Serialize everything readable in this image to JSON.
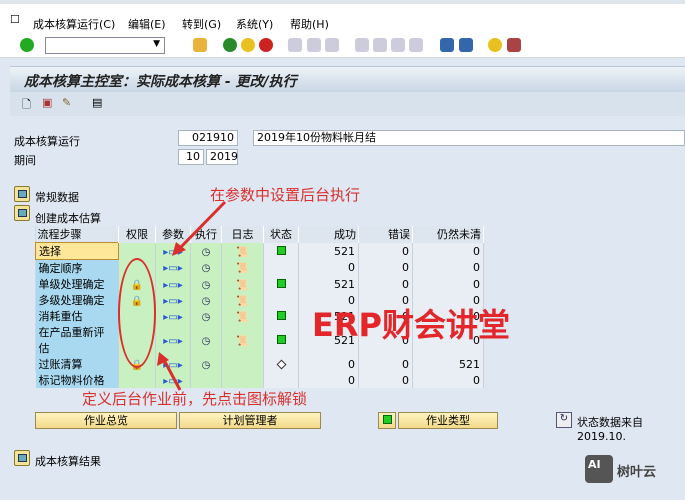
{
  "menu": [
    "成本核算运行(C)",
    "编辑(E)",
    "转到(G)",
    "系统(Y)",
    "帮助(H)"
  ],
  "title": "成本核算主控室：实际成本核算 - 更改/执行",
  "header": {
    "run_label": "成本核算运行",
    "run_value": "021910",
    "run_desc": "2019年10份物料帐月结",
    "period_label": "期间",
    "period": "10",
    "year": "2019"
  },
  "sections": {
    "general": "常规数据",
    "create": "创建成本估算",
    "results": "成本核算结果"
  },
  "table": {
    "columns": [
      "流程步骤",
      "权限",
      "参数",
      "执行",
      "日志",
      "状态",
      "成功",
      "错误",
      "仍然未清"
    ],
    "rows": [
      {
        "step": "选择",
        "lock": false,
        "exec": true,
        "log": true,
        "status": "green",
        "ok": "521",
        "err": "0",
        "open": "0"
      },
      {
        "step": "确定顺序",
        "lock": false,
        "exec": true,
        "log": true,
        "status": "",
        "ok": "0",
        "err": "0",
        "open": "0"
      },
      {
        "step": "单级处理确定",
        "lock": true,
        "exec": true,
        "log": true,
        "status": "green",
        "ok": "521",
        "err": "0",
        "open": "0"
      },
      {
        "step": "多级处理确定",
        "lock": true,
        "exec": true,
        "log": true,
        "status": "",
        "ok": "0",
        "err": "0",
        "open": "0"
      },
      {
        "step": "消耗重估",
        "lock": false,
        "exec": true,
        "log": true,
        "status": "green",
        "ok": "521",
        "err": "0",
        "open": "0"
      },
      {
        "step": "在产品重新评估",
        "lock": false,
        "exec": true,
        "log": true,
        "status": "green",
        "ok": "521",
        "err": "0",
        "open": "0"
      },
      {
        "step": "过账清算",
        "lock": true,
        "exec": true,
        "log": false,
        "status": "diamond",
        "ok": "0",
        "err": "0",
        "open": "521"
      },
      {
        "step": "标记物料价格",
        "lock": false,
        "exec": false,
        "log": false,
        "status": "",
        "ok": "0",
        "err": "0",
        "open": "0"
      }
    ]
  },
  "buttons": {
    "overview": "作业总览",
    "scheduler": "计划管理者",
    "jobtype": "作业类型"
  },
  "status_text": "状态数据来自 2019.10.",
  "annotations": {
    "top": "在参数中设置后台执行",
    "bottom": "定义后台作业前，先点击图标解锁",
    "watermark": "ERP财会讲堂",
    "logo": "树叶云"
  }
}
